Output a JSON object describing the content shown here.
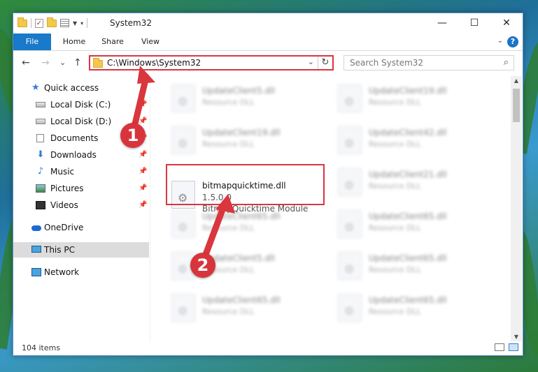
{
  "window": {
    "title": "System32",
    "controls": {
      "minimize": "—",
      "maximize": "☐",
      "close": "✕"
    }
  },
  "ribbon": {
    "tabs": [
      "File",
      "Home",
      "Share",
      "View"
    ],
    "help": "?"
  },
  "navigation": {
    "back": "←",
    "forward": "→",
    "recent": "⌄",
    "up": "↑"
  },
  "address": {
    "path": "C:\\Windows\\System32",
    "refresh": "↻"
  },
  "search": {
    "placeholder": "Search System32"
  },
  "sidebar": {
    "items": [
      {
        "label": "Quick access",
        "icon": "star-icon"
      },
      {
        "label": "Local Disk (C:)",
        "icon": "disk-icon",
        "pinned": true
      },
      {
        "label": "Local Disk (D:)",
        "icon": "disk-icon",
        "pinned": true
      },
      {
        "label": "Documents",
        "icon": "document-icon",
        "pinned": true
      },
      {
        "label": "Downloads",
        "icon": "download-icon",
        "pinned": true
      },
      {
        "label": "Music",
        "icon": "music-icon",
        "pinned": true
      },
      {
        "label": "Pictures",
        "icon": "picture-icon",
        "pinned": true
      },
      {
        "label": "Videos",
        "icon": "video-icon",
        "pinned": true
      },
      {
        "label": "OneDrive",
        "icon": "cloud-icon"
      },
      {
        "label": "This PC",
        "icon": "computer-icon",
        "selected": true
      },
      {
        "label": "Network",
        "icon": "network-icon"
      }
    ]
  },
  "files": {
    "left": [
      {
        "name": "UpdateClient5.dll",
        "type": "Resource DLL"
      },
      {
        "name": "UpdateClient19.dll",
        "type": "Resource DLL"
      },
      {
        "name": "UpdateClient65.dll",
        "type": "Resource DLL"
      },
      {
        "name": "UpdateClient5.dll",
        "type": "Resource DLL"
      },
      {
        "name": "UpdateClient65.dll",
        "type": "Resource DLL"
      }
    ],
    "right": [
      {
        "name": "UpdateClient19.dll",
        "type": "Resource DLL"
      },
      {
        "name": "UpdateClient42.dll",
        "type": "Resource DLL"
      },
      {
        "name": "UpdateClient21.dll",
        "type": "Resource DLL"
      },
      {
        "name": "UpdateClient65.dll",
        "type": "Resource DLL"
      },
      {
        "name": "UpdateClient65.dll",
        "type": "Resource DLL"
      },
      {
        "name": "UpdateClient65.dll",
        "type": "Resource DLL"
      }
    ],
    "highlighted": {
      "name": "bitmapquicktime.dll",
      "version": "1.5.0.0",
      "description": "BitmapQuicktime Module"
    }
  },
  "status": {
    "item_count": "104 items"
  },
  "annotations": {
    "step1": "1",
    "step2": "2",
    "color": "#d9363e"
  },
  "colors": {
    "accent": "#1979ca",
    "highlight": "#d9363e"
  }
}
